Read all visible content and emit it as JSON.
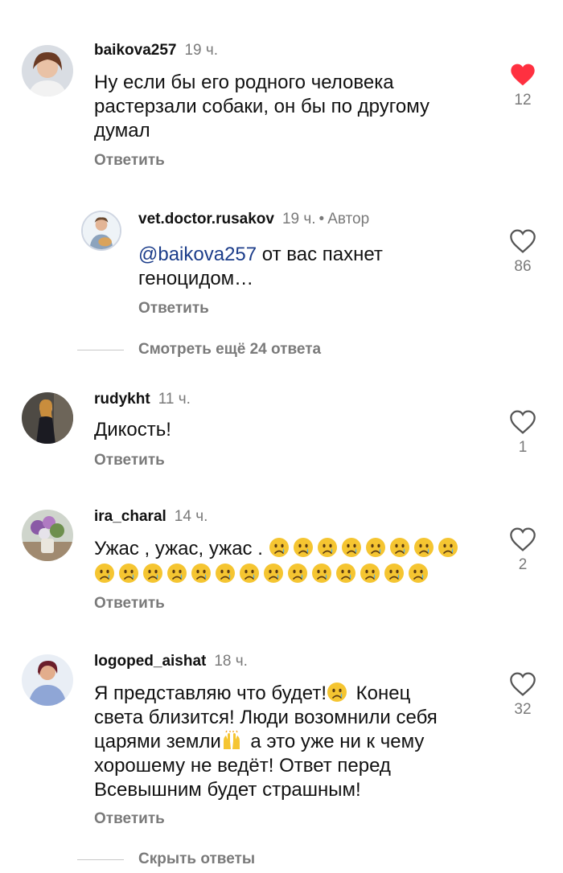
{
  "comments": [
    {
      "username": "baikova257",
      "time": "19 ч.",
      "lines": [
        "Ну если бы его родного человека",
        "растерзали собаки, он бы по другому",
        "думал"
      ],
      "reply_label": "Ответить",
      "likes": "12",
      "liked": true,
      "like_color": "#ff3040"
    },
    {
      "username": "vet.doctor.rusakov",
      "time": "19 ч.",
      "author_label": "Автор",
      "mention": "@baikova257",
      "line1_rest": " от вас пахнет",
      "line2": "геноцидом…",
      "reply_label": "Ответить",
      "likes": "86",
      "liked": false
    },
    {
      "username": "rudykht",
      "time": "11 ч.",
      "text": "Дикость!",
      "reply_label": "Ответить",
      "likes": "1",
      "liked": false
    },
    {
      "username": "ira_charal",
      "time": "14 ч.",
      "text": "Ужас , ужас, ужас . ",
      "emoji_name": "crying-face",
      "emoji_line1_count": 8,
      "emoji_line2_count": 14,
      "reply_label": "Ответить",
      "likes": "2",
      "liked": false
    },
    {
      "username": "logoped_aishat",
      "time": "18 ч.",
      "line1": "Я представляю что будет!",
      "line1_b": " Конец",
      "line2": "света близится! Люди возомнили себя",
      "line3": "царями  земли",
      "line3_b": " а это уже ни к чему",
      "line4": "хорошему не ведёт! Ответ перед",
      "line5": "Всевышним  будет страшным!",
      "reply_label": "Ответить",
      "likes": "32",
      "liked": false
    }
  ],
  "thread_more": "Смотреть ещё 24 ответа",
  "thread_hide": "Скрыть ответы",
  "colors": {
    "muted": "#7a7a7a",
    "mention": "#1c3d8a",
    "heart_active": "#ff3040"
  },
  "icons": {
    "like": "heart-icon",
    "emoji": "crying-face-emoji",
    "raised_hands": "raised-hands-emoji"
  }
}
